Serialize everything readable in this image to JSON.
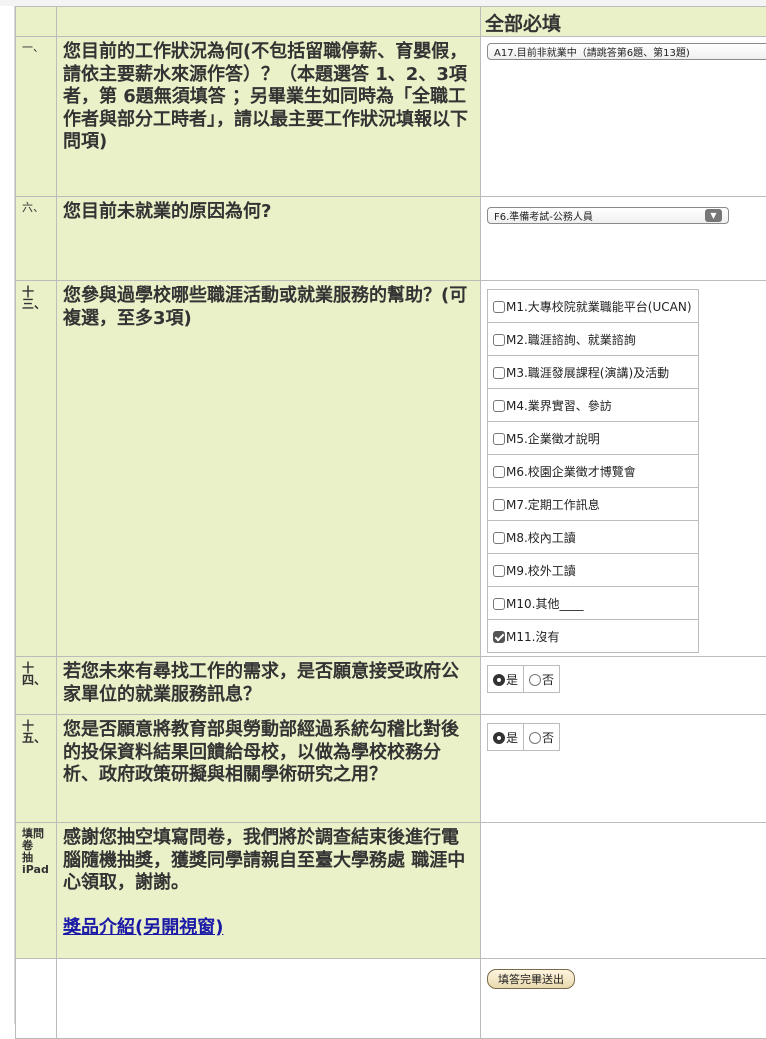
{
  "header": {
    "required_label": "全部必填"
  },
  "questions": {
    "q1": {
      "num": "一、",
      "text": "您目前的工作狀況為何(不包括留職停薪、育嬰假，請依主要薪水來源作答）？（本題選答 1、2、3項者，第 6題無須填答 ；另畢業生如同時為「全職工作者與部分工時者」，請以最主要工作狀況填報以下問項)",
      "selected": "A17.目前非就業中（請跳答第6題、第13題)"
    },
    "q6": {
      "num": "六、",
      "text": "您目前未就業的原因為何?",
      "selected": "F6.準備考試-公務人員"
    },
    "q13": {
      "num_lines": [
        "十",
        "三、"
      ],
      "text": "您參與過學校哪些職涯活動或就業服務的幫助？(可複選，至多3項)",
      "options": [
        {
          "label": "M1.大專校院就業職能平台(UCAN)",
          "checked": false
        },
        {
          "label": "M2.職涯諮詢、就業諮詢",
          "checked": false
        },
        {
          "label": "M3.職涯發展課程(演講)及活動",
          "checked": false
        },
        {
          "label": "M4.業界實習、參訪",
          "checked": false
        },
        {
          "label": "M5.企業徵才說明",
          "checked": false
        },
        {
          "label": "M6.校園企業徵才博覽會",
          "checked": false
        },
        {
          "label": "M7.定期工作訊息",
          "checked": false
        },
        {
          "label": "M8.校內工讀",
          "checked": false
        },
        {
          "label": "M9.校外工讀",
          "checked": false
        },
        {
          "label": "M10.其他____",
          "checked": false
        },
        {
          "label": "M11.沒有",
          "checked": true
        }
      ]
    },
    "q14": {
      "num_lines": [
        "十",
        "四、"
      ],
      "text": "若您未來有尋找工作的需求，是否願意接受政府公家單位的就業服務訊息？",
      "yes": "是",
      "no": "否",
      "selected": "yes"
    },
    "q15": {
      "num_lines": [
        "十",
        "五、"
      ],
      "text": "您是否願意將教育部與勞動部經過系統勾稽比對後的投保資料結果回饋給母校，以做為學校校務分析、政府政策研擬與相關學術研究之用？",
      "yes": "是",
      "no": "否",
      "selected": "yes"
    },
    "ipad": {
      "num_lines": [
        "填問",
        "卷",
        "抽",
        "iPad"
      ],
      "text": "感謝您抽空填寫問卷，我們將於調查結束後進行電腦隨機抽獎，獲獎同學請親自至臺大學務處 職涯中心領取，謝謝。",
      "link": "獎品介紹(另開視窗)"
    }
  },
  "submit_label": "填答完畢送出"
}
